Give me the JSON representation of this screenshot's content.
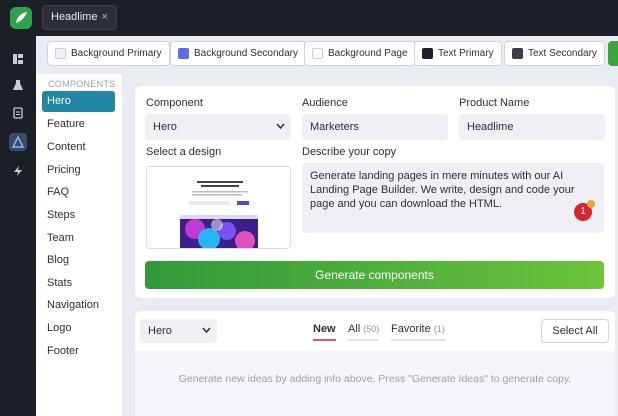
{
  "app": {
    "tab_label": "Headlime",
    "tab_close": "×"
  },
  "rail_icons": [
    "layout-icon",
    "flask-icon",
    "document-icon",
    "triangle-icon",
    "bolt-icon"
  ],
  "swatches": [
    {
      "label": "Background Primary",
      "color": "#eef0f6"
    },
    {
      "label": "Background Secondary",
      "color": "#5b6ee1"
    },
    {
      "label": "Background Page",
      "color": "#ffffff"
    },
    {
      "label": "Text Primary",
      "color": "#1c1f26"
    },
    {
      "label": "Text Secondary",
      "color": "#3a3f4b"
    }
  ],
  "sidebar": {
    "header": "COMPONENTS",
    "items": [
      "Hero",
      "Feature",
      "Content",
      "Pricing",
      "FAQ",
      "Steps",
      "Team",
      "Blog",
      "Stats",
      "Navigation",
      "Logo",
      "Footer"
    ],
    "active": "Hero"
  },
  "form": {
    "component_label": "Component",
    "component_value": "Hero",
    "audience_label": "Audience",
    "audience_value": "Marketers",
    "product_label": "Product Name",
    "product_value": "Headlime",
    "design_label": "Select a design",
    "copy_label": "Describe your copy",
    "copy_value": "Generate landing pages in mere minutes with our AI Landing Page Builder. We write, design and code your page and you can download the HTML.",
    "badge_count": "1",
    "generate_label": "Generate components"
  },
  "results": {
    "filter_value": "Hero",
    "tabs": [
      {
        "label": "New",
        "count": ""
      },
      {
        "label": "All",
        "count": "(50)"
      },
      {
        "label": "Favorite",
        "count": "(1)"
      }
    ],
    "select_all": "Select All",
    "hint": "Generate new ideas by adding info above. Press \"Generate Ideas\" to generate copy."
  },
  "colors": {
    "accent": "#1f86a3",
    "generate": "#3aa63b",
    "badge": "#d3262e"
  }
}
